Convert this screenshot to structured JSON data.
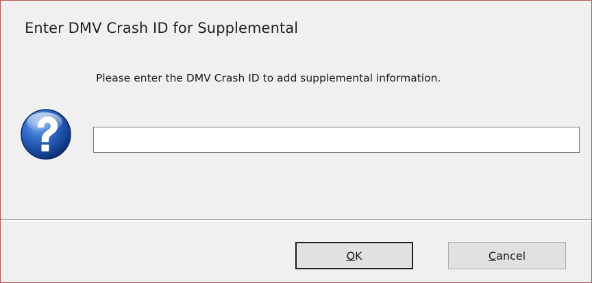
{
  "dialog": {
    "title": "Enter DMV Crash ID for Supplemental",
    "prompt": "Please enter the DMV Crash ID to add supplemental information.",
    "icon": "question-icon",
    "input_value": "",
    "ok_mnemonic": "O",
    "ok_rest": "K",
    "cancel_mnemonic": "C",
    "cancel_rest": "ancel"
  },
  "colors": {
    "icon_blue": "#1f4fa8",
    "border": "#b45656",
    "background": "#f0f0f0"
  }
}
